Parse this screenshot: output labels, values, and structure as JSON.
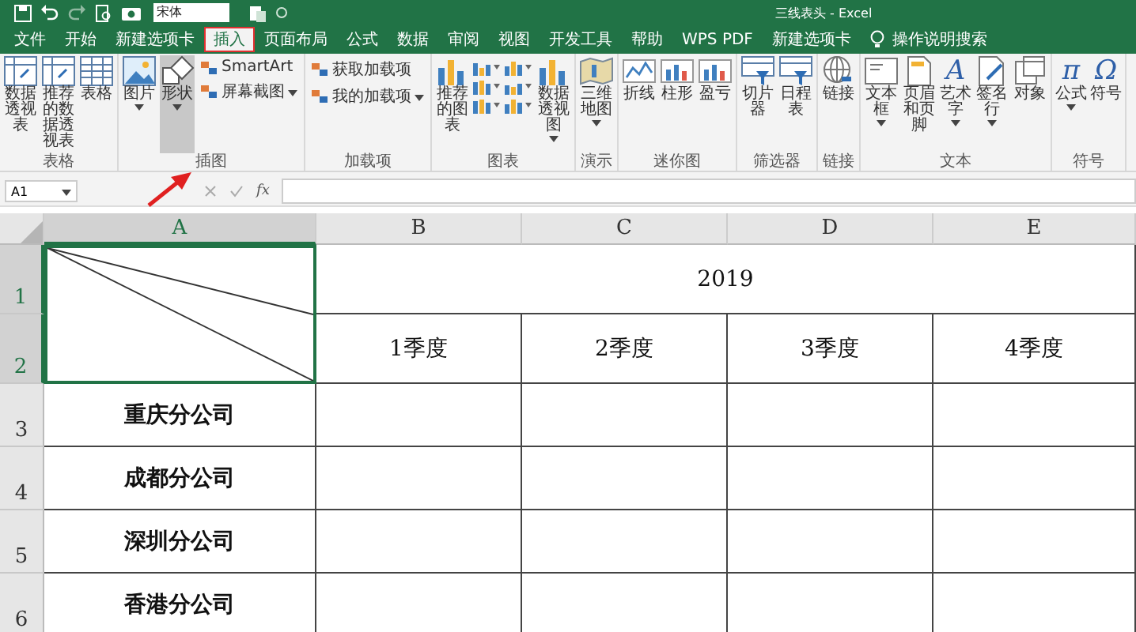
{
  "title_bar": {
    "font_box": "宋体",
    "title": "三线表头 - Excel"
  },
  "tabs": [
    {
      "label": "文件",
      "selected": false
    },
    {
      "label": "开始",
      "selected": false
    },
    {
      "label": "新建选项卡",
      "selected": false
    },
    {
      "label": "插入",
      "selected": true
    },
    {
      "label": "页面布局",
      "selected": false
    },
    {
      "label": "公式",
      "selected": false
    },
    {
      "label": "数据",
      "selected": false
    },
    {
      "label": "审阅",
      "selected": false
    },
    {
      "label": "视图",
      "selected": false
    },
    {
      "label": "开发工具",
      "selected": false
    },
    {
      "label": "帮助",
      "selected": false
    },
    {
      "label": "WPS PDF",
      "selected": false
    },
    {
      "label": "新建选项卡",
      "selected": false
    }
  ],
  "tell_me": "操作说明搜索",
  "ribbon": [
    {
      "label": "表格",
      "items": [
        {
          "kind": "large",
          "label": "数据透视表",
          "dropdown": false,
          "pressed": false
        },
        {
          "kind": "large",
          "label": "推荐的数据透视表",
          "dropdown": false,
          "pressed": false
        },
        {
          "kind": "large",
          "label": "表格",
          "dropdown": false,
          "pressed": false
        }
      ]
    },
    {
      "label": "插图",
      "items": [
        {
          "kind": "large",
          "label": "图片",
          "dropdown": true,
          "pressed": false
        },
        {
          "kind": "large",
          "label": "形状",
          "dropdown": true,
          "pressed": true
        },
        {
          "kind": "stack",
          "items": [
            {
              "label": "SmartArt",
              "dropdown": false
            },
            {
              "label": "屏幕截图",
              "dropdown": true
            }
          ]
        }
      ]
    },
    {
      "label": "加载项",
      "items": [
        {
          "kind": "stack",
          "items": [
            {
              "label": "获取加载项",
              "dropdown": false
            },
            {
              "label": "我的加载项",
              "dropdown": true
            }
          ]
        }
      ]
    },
    {
      "label": "图表",
      "items": [
        {
          "kind": "large",
          "label": "推荐的图表",
          "dropdown": false,
          "pressed": false
        },
        {
          "kind": "gallery"
        },
        {
          "kind": "large",
          "label": "数据透视图",
          "dropdown": true,
          "pressed": false
        }
      ]
    },
    {
      "label": "演示",
      "items": [
        {
          "kind": "large",
          "label": "三维地图",
          "dropdown": true,
          "pressed": false
        }
      ]
    },
    {
      "label": "迷你图",
      "items": [
        {
          "kind": "large",
          "label": "折线",
          "dropdown": false,
          "pressed": false
        },
        {
          "kind": "large",
          "label": "柱形",
          "dropdown": false,
          "pressed": false
        },
        {
          "kind": "large",
          "label": "盈亏",
          "dropdown": false,
          "pressed": false
        }
      ]
    },
    {
      "label": "筛选器",
      "items": [
        {
          "kind": "large",
          "label": "切片器",
          "dropdown": false,
          "pressed": false
        },
        {
          "kind": "large",
          "label": "日程表",
          "dropdown": false,
          "pressed": false
        }
      ]
    },
    {
      "label": "链接",
      "items": [
        {
          "kind": "large",
          "label": "链接",
          "dropdown": false,
          "pressed": false
        }
      ]
    },
    {
      "label": "文本",
      "items": [
        {
          "kind": "large",
          "label": "文本框",
          "dropdown": true,
          "pressed": false
        },
        {
          "kind": "large",
          "label": "页眉和页脚",
          "dropdown": false,
          "pressed": false
        },
        {
          "kind": "large",
          "label": "艺术字",
          "dropdown": true,
          "pressed": false,
          "glyph": "A"
        },
        {
          "kind": "large",
          "label": "签名行",
          "dropdown": true,
          "pressed": false
        },
        {
          "kind": "large",
          "label": "对象",
          "dropdown": false,
          "pressed": false
        }
      ]
    },
    {
      "label": "符号",
      "items": [
        {
          "kind": "large",
          "label": "公式",
          "dropdown": true,
          "pressed": false,
          "glyph": "π"
        },
        {
          "kind": "large",
          "label": "符号",
          "dropdown": false,
          "pressed": false,
          "glyph": "Ω"
        }
      ]
    }
  ],
  "formula_bar": {
    "name_box": "A1",
    "fx": "fx"
  },
  "sheet": {
    "columns": [
      {
        "label": "A",
        "selected": true
      },
      {
        "label": "B",
        "selected": false
      },
      {
        "label": "C",
        "selected": false
      },
      {
        "label": "D",
        "selected": false
      },
      {
        "label": "E",
        "selected": false
      }
    ],
    "rows": [
      {
        "number": "1",
        "selected": true
      },
      {
        "number": "2",
        "selected": true
      },
      {
        "number": "3",
        "selected": false
      },
      {
        "number": "4",
        "selected": false
      },
      {
        "number": "5",
        "selected": false
      },
      {
        "number": "6",
        "selected": false
      }
    ],
    "year": "2019",
    "quarters": [
      "1季度",
      "2季度",
      "3季度",
      "4季度"
    ],
    "companies": [
      "重庆分公司",
      "成都分公司",
      "深圳分公司",
      "香港分公司"
    ]
  }
}
